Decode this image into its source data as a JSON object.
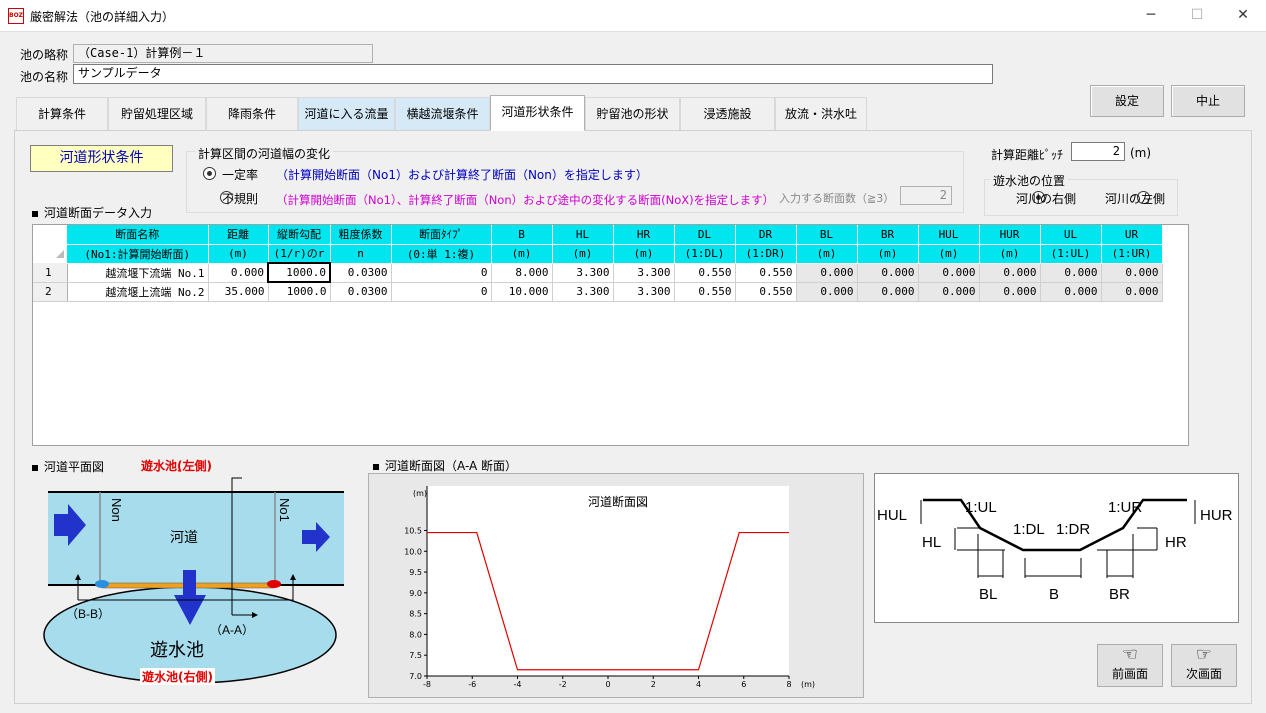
{
  "window": {
    "title": "厳密解法（池の詳細入力）",
    "icon_label": "BOZ"
  },
  "header": {
    "abbr_label": "池の略称",
    "abbr_value": "（Case-1）計算例－１",
    "name_label": "池の名称",
    "name_value": "サンプルデータ"
  },
  "buttons": {
    "set": "設定",
    "cancel": "中止",
    "prev": "前画面",
    "next": "次画面"
  },
  "tabs": [
    "計算条件",
    "貯留処理区域",
    "降雨条件",
    "河道に入る流量",
    "横越流堰条件",
    "河道形状条件",
    "貯留池の形状",
    "浸透施設",
    "放流・洪水吐"
  ],
  "section_label": "河道形状条件",
  "width_change": {
    "title": "計算区間の河道幅の変化",
    "opt_constant": "一定率",
    "opt_constant_desc": "（計算開始断面（No1）および計算終了断面（Non）を指定します）",
    "opt_irregular": "不規則",
    "opt_irregular_desc": "（計算開始断面（No1）、計算終了断面（Non）および途中の変化する断面(NoX)を指定します）",
    "section_count_label": "入力する断面数（≧3）",
    "section_count_value": "2"
  },
  "pitch": {
    "label": "計算距離ﾋﾟｯﾁ",
    "value": "2",
    "unit": "(m)"
  },
  "pond_position": {
    "title": "遊水池の位置",
    "right": "河川の右側",
    "left": "河川の左側"
  },
  "grid_title": "河道断面データ入力",
  "grid": {
    "headers1": [
      "断面名称",
      "距離",
      "縦断勾配",
      "粗度係数",
      "断面ﾀｲﾌﾟ",
      "B",
      "HL",
      "HR",
      "DL",
      "DR",
      "BL",
      "BR",
      "HUL",
      "HUR",
      "UL",
      "UR"
    ],
    "headers2": [
      "(No1:計算開始断面)",
      "(m)",
      "(1/r)のr",
      "n",
      "(0:単 1:複)",
      "(m)",
      "(m)",
      "(m)",
      "(1:DL)",
      "(1:DR)",
      "(m)",
      "(m)",
      "(m)",
      "(m)",
      "(1:UL)",
      "(1:UR)"
    ],
    "rows": [
      [
        "1",
        "越流堰下流端 No.1",
        "0.000",
        "1000.0",
        "0.0300",
        "0",
        "8.000",
        "3.300",
        "3.300",
        "0.550",
        "0.550",
        "0.000",
        "0.000",
        "0.000",
        "0.000",
        "0.000",
        "0.000"
      ],
      [
        "2",
        "越流堰上流端 No.2",
        "35.000",
        "1000.0",
        "0.0300",
        "0",
        "10.000",
        "3.300",
        "3.300",
        "0.550",
        "0.550",
        "0.000",
        "0.000",
        "0.000",
        "0.000",
        "0.000",
        "0.000"
      ]
    ]
  },
  "plan_view": {
    "title": "河道平面図",
    "pond_left": "遊水池(左側)",
    "pond_right": "遊水池(右側)",
    "river": "河道",
    "pond": "遊水池",
    "non": "Non",
    "no1": "No1",
    "bb": "（B-B）",
    "aa": "（A-A）"
  },
  "section_view": {
    "title": "河道断面図（A-A 断面）",
    "chart_title": "河道断面図",
    "y_unit": "(m)",
    "x_unit": "(m)"
  },
  "chart_data": {
    "type": "line",
    "title": "河道断面図",
    "xlabel": "(m)",
    "ylabel": "(m)",
    "xlim": [
      -8,
      8
    ],
    "ylim": [
      7.0,
      10.8
    ],
    "x_ticks": [
      "-8",
      "-6",
      "-4",
      "-2",
      "0",
      "2",
      "4",
      "6",
      "8"
    ],
    "y_ticks": [
      "7.0",
      "7.5",
      "8.0",
      "8.5",
      "9.0",
      "9.5",
      "10.0",
      "10.5"
    ],
    "series": [
      {
        "x": [
          -8.0,
          -5.8,
          -4.0,
          4.0,
          5.8,
          8.0
        ],
        "y": [
          10.45,
          10.45,
          7.15,
          7.15,
          10.45,
          10.45
        ],
        "color": "#e00000"
      }
    ]
  },
  "schematic": {
    "ul": "1:UL",
    "ur": "1:UR",
    "dl": "1:DL",
    "dr": "1:DR",
    "hul": "HUL",
    "hur": "HUR",
    "hl": "HL",
    "hr": "HR",
    "bl": "BL",
    "b": "B",
    "br": "BR"
  }
}
